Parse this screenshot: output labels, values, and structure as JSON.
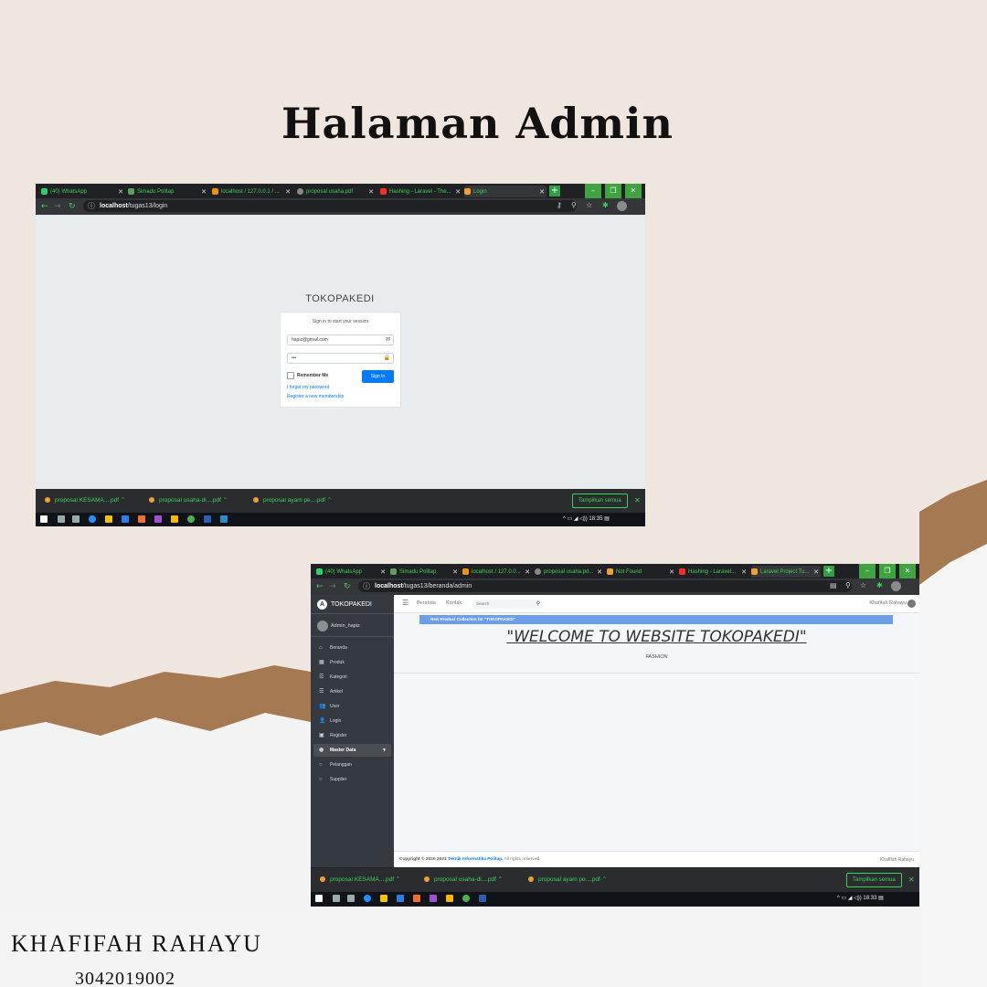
{
  "page": {
    "title": "Halaman Admin",
    "author_name": "KHAFIFAH RAHAYU",
    "author_id": "3042019002"
  },
  "login_window": {
    "tabs": [
      "(40) WhatsApp",
      "Simadu Politap",
      "localhost / 127.0.0.1 / ...",
      "proposal usaha.pdf",
      "Hashing - Laravel - The...",
      "Login"
    ],
    "url_host": "localhost",
    "url_path": "/tugas13/login",
    "logo_text": "TOKOPAKEDI",
    "login_msg": "Sign in to start your session",
    "email_value": "hapiz@gmail.com",
    "password_value": "•••",
    "remember_label": "Remember Me",
    "signin_label": "Sign In",
    "forgot_link": "I forgot my password",
    "register_link": "Register a new membership",
    "downloads": [
      "proposal KESAMA....pdf",
      "proposal usaha-di....pdf",
      "proposal ayam pe....pdf"
    ],
    "show_all": "Tampilkan semua",
    "clock": "18:35"
  },
  "admin_window": {
    "tabs": [
      "(40) WhatsApp",
      "Simadu Politap",
      "localhost / 127.0.0...",
      "proposal usaha.pd...",
      "Not Found",
      "Hashing - Laravel...",
      "Laravel Project Tu..."
    ],
    "url_host": "localhost",
    "url_path": "/tugas13/beranda/admin",
    "brand": "TOKOPAKEDI",
    "brand_logo": "A",
    "user": "Admin_hapiz",
    "menu": [
      {
        "label": "Beranda",
        "icon": "home-icon",
        "glyph": "⌂"
      },
      {
        "label": "Produk",
        "icon": "grid-icon",
        "glyph": "▦"
      },
      {
        "label": "Kategori",
        "icon": "list-icon",
        "glyph": "☰"
      },
      {
        "label": "Artikel",
        "icon": "list-icon",
        "glyph": "☰"
      },
      {
        "label": "User",
        "icon": "users-icon",
        "glyph": "👥"
      },
      {
        "label": "Login",
        "icon": "user-icon",
        "glyph": "👤"
      },
      {
        "label": "Register",
        "icon": "id-card-icon",
        "glyph": "▣"
      },
      {
        "label": "Master Data",
        "icon": "dashboard-icon",
        "glyph": "◉"
      },
      {
        "label": "Pelanggan",
        "icon": "circle-icon",
        "glyph": "○"
      },
      {
        "label": "Supplier",
        "icon": "circle-icon",
        "glyph": "○"
      }
    ],
    "nav_home": "Beranda",
    "nav_contact": "Kontak",
    "search_placeholder": "Search",
    "nav_user": "Khafifah Rahayu",
    "banner": "New Product Collection for \"TOKOPAKEDI\"",
    "welcome": "\"WELCOME TO WEBSITE TOKOPAKEDI\"",
    "fashion": "FASHION",
    "footer_copy_prefix": "Copyright © 2020 2021",
    "footer_copy_link": "Teknik Informatika Politap.",
    "footer_copy_suffix": "All rights reserved.",
    "footer_right": "Khafifah Rahayu",
    "downloads": [
      "proposal KESAMA....pdf",
      "proposal usaha-di....pdf",
      "proposal ayam pe....pdf"
    ],
    "show_all": "Tampilkan semua",
    "clock": "18:33"
  },
  "colors": {
    "background": "#efe6df",
    "chrome_green": "#39d353",
    "sidebar": "#343a40",
    "signin_blue": "#007bff",
    "banner_blue": "#6d9eeb"
  }
}
